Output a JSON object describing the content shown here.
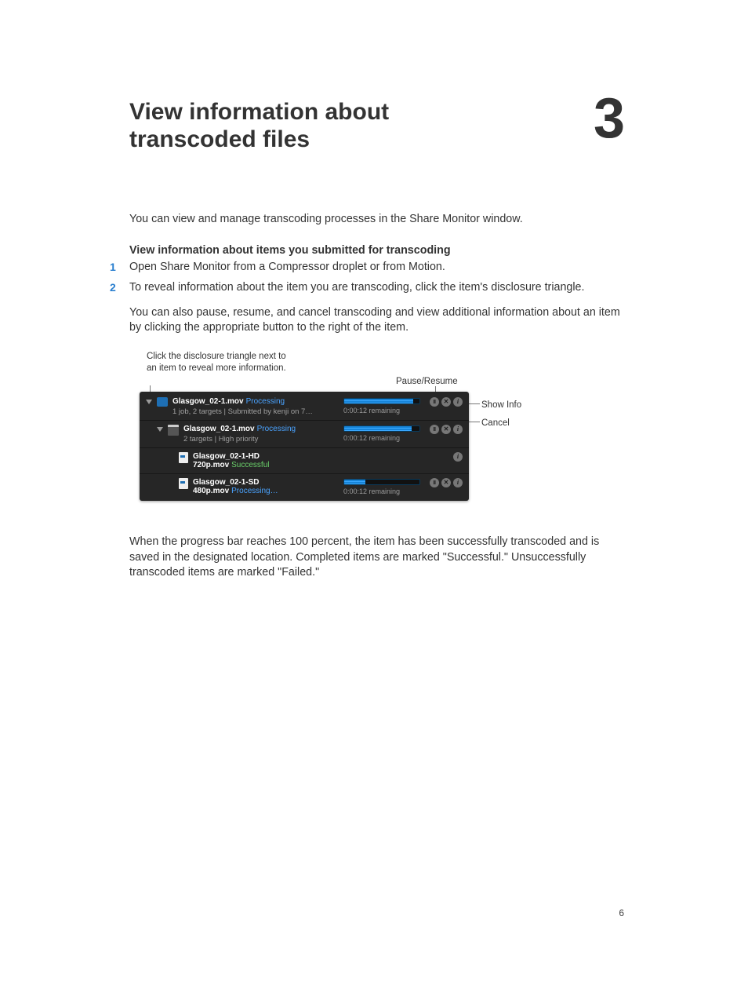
{
  "chapterNumber": "3",
  "chapterTitle": "View information about transcoded files",
  "intro": "You can view and manage transcoding processes in the Share Monitor window.",
  "sectionTitle": "View information about items you submitted for transcoding",
  "steps": [
    "Open Share Monitor from a Compressor droplet or from Motion.",
    "To reveal information about the item you are transcoding, click the item's disclosure triangle."
  ],
  "followup": "You can also pause, resume, and cancel transcoding and view additional information about an item by clicking the appropriate button to the right of the item.",
  "callouts": {
    "topLeft": "Click the disclosure triangle next to an item to reveal more information.",
    "pauseResume": "Pause/Resume",
    "showInfo": "Show Info",
    "cancel": "Cancel"
  },
  "rows": [
    {
      "fname": "Glasgow_02-1.mov",
      "status": "Processing",
      "sub": "1 job, 2 targets  |  Submitted by kenji on 7…",
      "remaining": "0:00:12 remaining",
      "progressPct": 92,
      "buttons": [
        "pause",
        "cancel",
        "info"
      ],
      "iconType": "folder",
      "indent": 0,
      "disclosure": "down"
    },
    {
      "fname": "Glasgow_02-1.mov",
      "status": "Processing",
      "sub": "2 targets  |  High priority",
      "remaining": "0:00:12 remaining",
      "progressPct": 90,
      "buttons": [
        "pause",
        "cancel",
        "info"
      ],
      "iconType": "clap",
      "indent": 1,
      "disclosure": "down"
    },
    {
      "fname": "Glasgow_02-1-HD 720p.mov",
      "status": "Successful",
      "sub": "",
      "remaining": "",
      "progressPct": null,
      "buttons": [
        "info"
      ],
      "iconType": "page",
      "indent": 2,
      "disclosure": ""
    },
    {
      "fname": "Glasgow_02-1-SD 480p.mov",
      "status": "Processing…",
      "sub": "",
      "remaining": "0:00:12 remaining",
      "progressPct": 28,
      "buttons": [
        "pause",
        "cancel",
        "info"
      ],
      "iconType": "page",
      "indent": 2,
      "disclosure": ""
    }
  ],
  "afterFigure": "When the progress bar reaches 100 percent, the item has been successfully transcoded and is saved in the designated location. Completed items are marked \"Successful.\" Unsuccessfully transcoded items are marked \"Failed.\"",
  "pageNumber": "6"
}
